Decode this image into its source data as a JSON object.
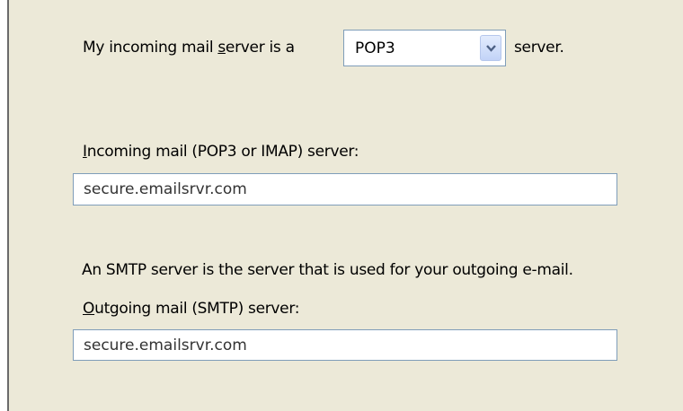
{
  "server_type": {
    "label_before": "My incoming mail ",
    "label_underlined": "s",
    "label_after": "erver is a",
    "selected_value": "POP3",
    "label_suffix": "server.",
    "arrow_icon": "chevron-down-icon"
  },
  "incoming": {
    "label_underlined": "I",
    "label_rest": "ncoming mail (POP3 or  IMAP) server:",
    "value": "secure.emailsrvr.com"
  },
  "smtp_info": {
    "text": "An SMTP server is the server that is used for your outgoing e-mail."
  },
  "outgoing": {
    "label_underlined": "O",
    "label_rest": "utgoing mail (SMTP) server:",
    "value": "secure.emailsrvr.com"
  },
  "colors": {
    "panel_background": "#ece9d8",
    "field_border": "#7f9db9",
    "dropdown_button": "#c2d3f7"
  }
}
